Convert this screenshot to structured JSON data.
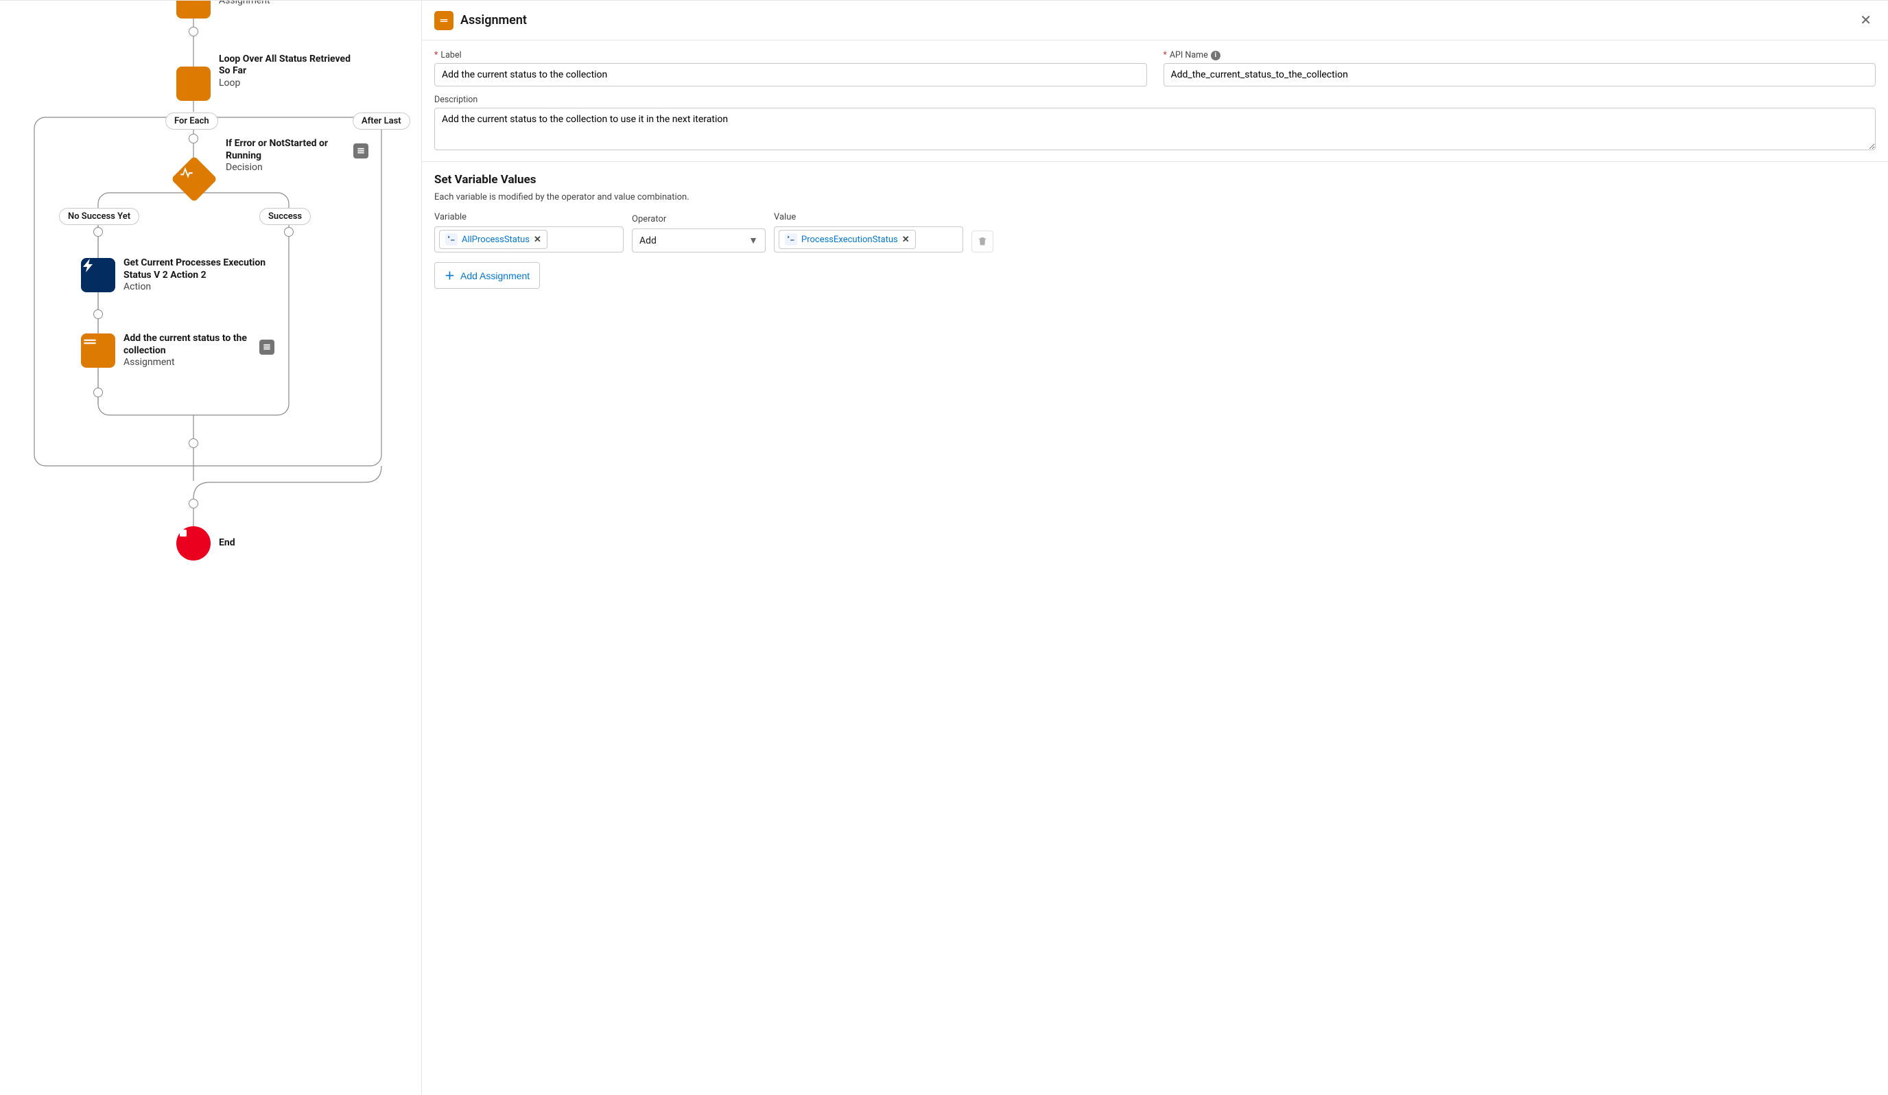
{
  "panel": {
    "title": "Assignment",
    "label_field": "Label",
    "label_value": "Add the current status to the collection",
    "apiname_field": "API Name",
    "apiname_value": "Add_the_current_status_to_the_collection",
    "description_field": "Description",
    "description_value": "Add the current status to the collection to use it in the next iteration",
    "section_title": "Set Variable Values",
    "section_desc": "Each variable is modified by the operator and value combination.",
    "col_variable": "Variable",
    "col_operator": "Operator",
    "col_value": "Value",
    "variable_chip": "AllProcessStatus",
    "operator_value": "Add",
    "value_chip": "ProcessExecutionStatus",
    "add_button": "Add Assignment"
  },
  "canvas": {
    "nodes": {
      "assignment_top_sub": "Assignment",
      "loop_title": "Loop Over All Status Retrieved So Far",
      "loop_sub": "Loop",
      "decision_title": "If Error or NotStarted or Running",
      "decision_sub": "Decision",
      "action_title": "Get Current Processes Execution Status V 2 Action 2",
      "action_sub": "Action",
      "assign2_title": "Add the current status to the collection",
      "assign2_sub": "Assignment",
      "end_title": "End"
    },
    "pills": {
      "for_each": "For Each",
      "after_last": "After Last",
      "no_success": "No Success Yet",
      "success": "Success"
    }
  }
}
